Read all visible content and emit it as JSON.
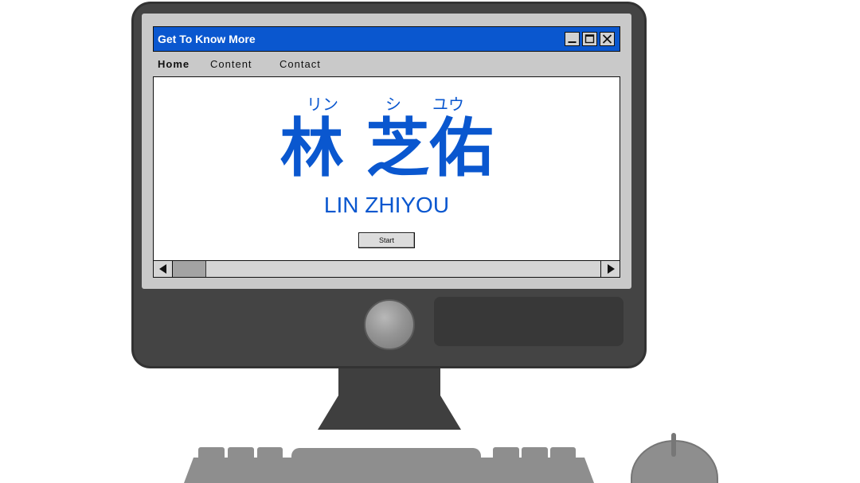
{
  "window": {
    "title": "Get To Know More",
    "control_icons": [
      "minimize-icon",
      "maximize-icon",
      "close-icon"
    ]
  },
  "menu": {
    "items": [
      {
        "label": "Home",
        "active": true
      },
      {
        "label": "Content",
        "active": false
      },
      {
        "label": "Contact",
        "active": false
      }
    ]
  },
  "hero": {
    "readings": [
      "リン",
      "シ",
      "ユウ"
    ],
    "name_cjk": "林 芝佑",
    "name_latin": "LIN ZHIYOU"
  },
  "start_button": {
    "label": "Start"
  },
  "scrollbar": {
    "position": 0,
    "icons": [
      "arrow-left-icon",
      "arrow-right-icon"
    ]
  },
  "colors": {
    "accent": "#0a57cf",
    "screen": "#c9c9c9",
    "monitor": "#444444",
    "peripherals": "#8e8e8e"
  }
}
